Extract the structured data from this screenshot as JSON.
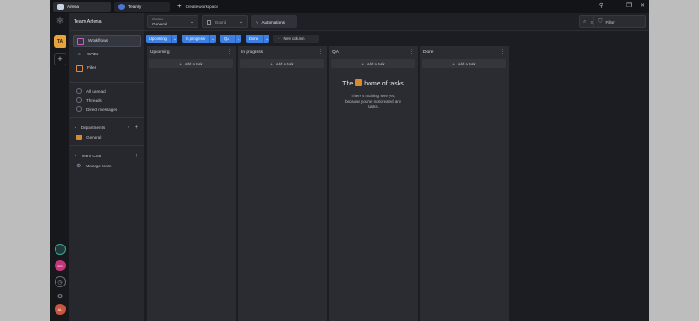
{
  "window": {
    "tabs": [
      {
        "label": "Arlena",
        "active": true
      },
      {
        "label": "Teamly",
        "active": false
      }
    ],
    "new_workspace": "Create workspace",
    "controls": [
      "notifications-icon",
      "minimize-icon",
      "maximize-icon",
      "close-icon"
    ]
  },
  "rail": {
    "workspace_initials": "TA",
    "avatar_initials_1": "BS",
    "avatar_initials_2": "AL"
  },
  "sidebar": {
    "title": "Team Arlena",
    "items": [
      {
        "label": "Workflows",
        "active": true
      },
      {
        "label": "SOPs",
        "active": false
      },
      {
        "label": "Files",
        "active": false
      }
    ],
    "lines": [
      {
        "label": "All unread"
      },
      {
        "label": "Threads"
      },
      {
        "label": "Direct messages"
      }
    ],
    "departments_label": "Departments",
    "departments": [
      {
        "label": "General"
      }
    ],
    "team_chat_label": "Team Chat",
    "team_chat_items": [
      {
        "label": "Manage team"
      }
    ]
  },
  "toolbar": {
    "workflow_caption": "Workflow",
    "workflow_value": "General",
    "board_value": "Board",
    "automations_label": "Automations",
    "search_placeholder": "Search...",
    "filter_label": "Filter"
  },
  "filters": {
    "chips": [
      "Upcoming",
      "In progress",
      "QA",
      "Done"
    ],
    "new_column": "New column"
  },
  "board": {
    "columns": [
      {
        "title": "Upcoming",
        "add_label": "Add a task"
      },
      {
        "title": "In progress",
        "add_label": "Add a task"
      },
      {
        "title": "QA",
        "add_label": "Add a task"
      },
      {
        "title": "Done",
        "add_label": "Add a task"
      }
    ],
    "empty_title_a": "The",
    "empty_title_b": "home of tasks",
    "empty_text": "There's nothing here yet, because you've not created any tasks."
  },
  "colors": {
    "accent": "#3d7fe0",
    "workspace": "#e8a33a",
    "background": "#1b1d22"
  }
}
